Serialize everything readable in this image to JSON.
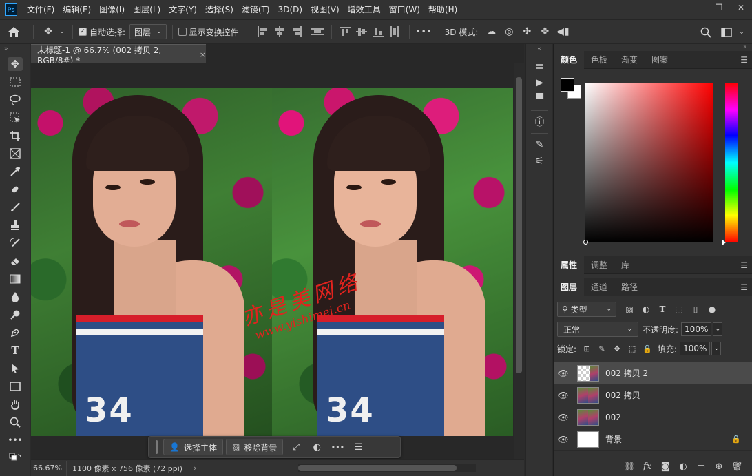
{
  "app": {
    "logo": "Ps",
    "menu": [
      "文件(F)",
      "编辑(E)",
      "图像(I)",
      "图层(L)",
      "文字(Y)",
      "选择(S)",
      "滤镜(T)",
      "3D(D)",
      "视图(V)",
      "增效工具",
      "窗口(W)",
      "帮助(H)"
    ],
    "window_controls": [
      "–",
      "❐",
      "✕"
    ]
  },
  "options_bar": {
    "auto_select_label": "自动选择:",
    "auto_select_checked": true,
    "auto_select_target": "图层",
    "show_transform_label": "显示变换控件",
    "show_transform_checked": false,
    "more": "•••",
    "mode_3d_label": "3D 模式:"
  },
  "document": {
    "tab_title": "未标题-1 @ 66.7% (002 拷贝 2, RGB/8#) *",
    "tab_close": "×",
    "watermark_line1": "亦是美网络",
    "watermark_line2": "www.yishimei.cn",
    "shirt_number": "34"
  },
  "contextual_taskbar": {
    "select_subject": "选择主体",
    "remove_background": "移除背景",
    "more": "•••"
  },
  "status_bar": {
    "zoom": "66.67%",
    "doc_info": "1100 像素 x 756 像素 (72 ppi)",
    "arrow": "›"
  },
  "color_panel": {
    "tabs": [
      "颜色",
      "色板",
      "渐变",
      "图案"
    ],
    "active_tab": 0,
    "foreground": "#000000",
    "background": "#ffffff",
    "hue": "#ff0000"
  },
  "properties_panel": {
    "tabs": [
      "属性",
      "调整",
      "库"
    ],
    "active_tab": 0
  },
  "layers_panel": {
    "tabs": [
      "图层",
      "通道",
      "路径"
    ],
    "active_tab": 0,
    "kind_filter": "类型",
    "blend_mode": "正常",
    "opacity_label": "不透明度:",
    "opacity": "100%",
    "lock_label": "锁定:",
    "fill_label": "填充:",
    "fill": "100%",
    "layers": [
      {
        "name": "002 拷贝 2",
        "selected": true,
        "thumb": "checker",
        "locked": false
      },
      {
        "name": "002 拷贝",
        "selected": false,
        "thumb": "photo",
        "locked": false
      },
      {
        "name": "002",
        "selected": false,
        "thumb": "photo",
        "locked": false
      },
      {
        "name": "背景",
        "selected": false,
        "thumb": "blank",
        "locked": true
      }
    ]
  }
}
